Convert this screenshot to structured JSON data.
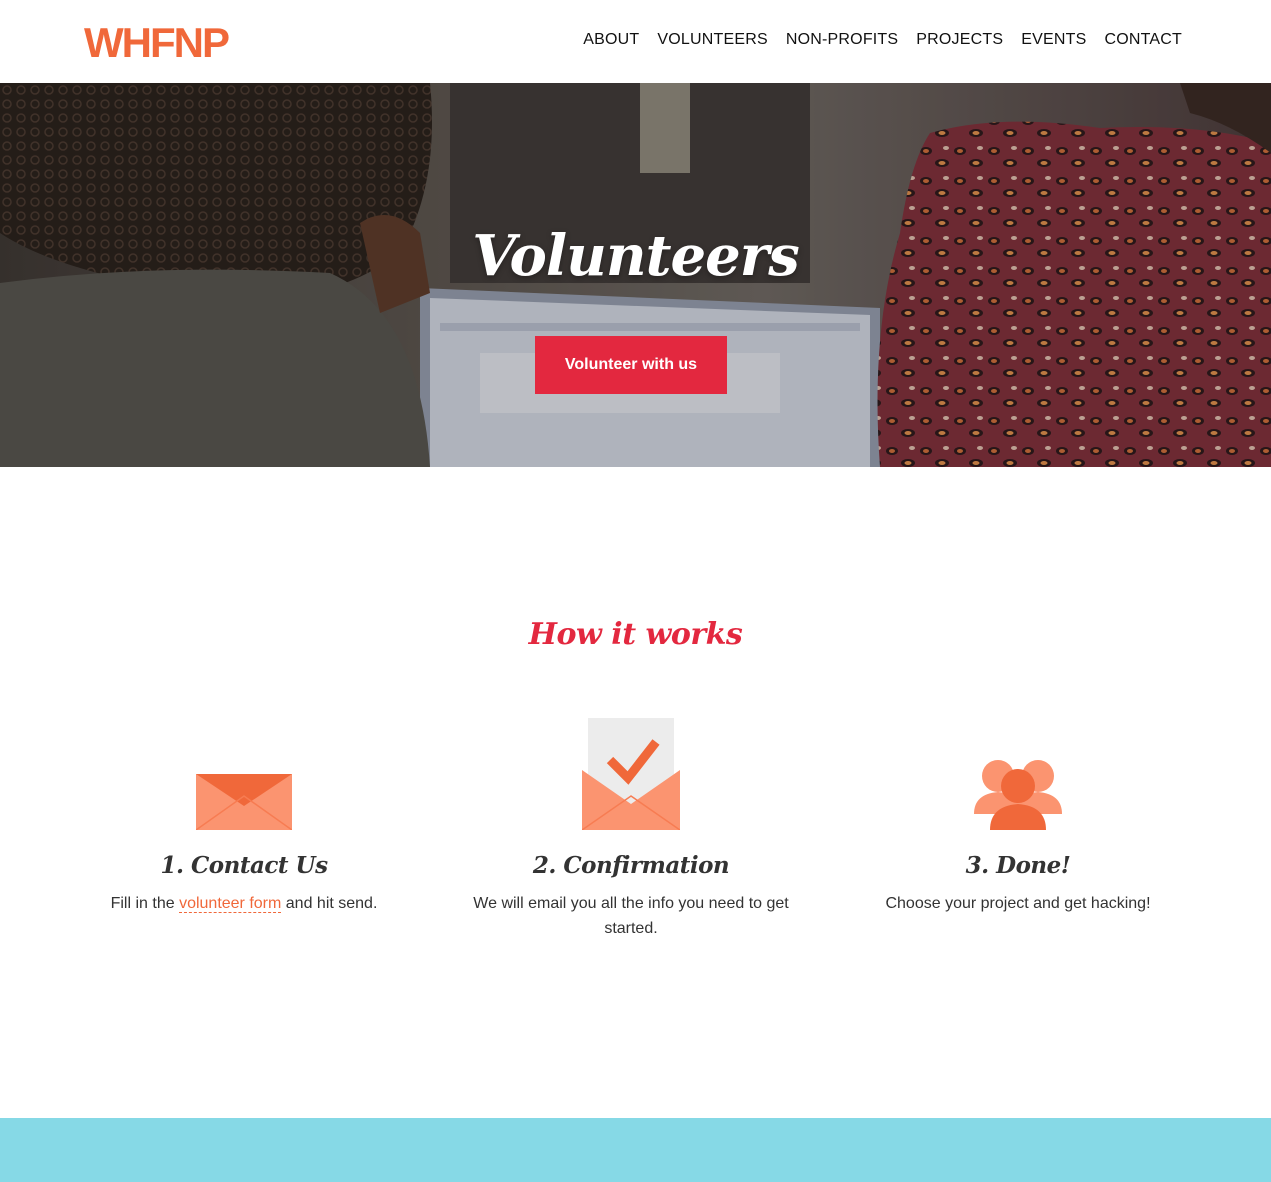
{
  "header": {
    "logo_text": "WHFNP",
    "nav": [
      {
        "label": "ABOUT"
      },
      {
        "label": "VOLUNTEERS"
      },
      {
        "label": "NON-PROFITS"
      },
      {
        "label": "PROJECTS"
      },
      {
        "label": "EVENTS"
      },
      {
        "label": "CONTACT"
      }
    ]
  },
  "hero": {
    "title": "Volunteers",
    "button_label": "Volunteer with us"
  },
  "how": {
    "title": "How it works",
    "steps": [
      {
        "icon": "envelope-icon",
        "title": "1. Contact Us",
        "text_before": "Fill in the ",
        "link": "volunteer form",
        "text_after": " and hit send."
      },
      {
        "icon": "confirmation-envelope-icon",
        "title": "2. Confirmation",
        "text": "We will email you all the info you need to get started."
      },
      {
        "icon": "group-icon",
        "title": "3. Done!",
        "text": "Choose your project and get hacking!"
      }
    ]
  },
  "colors": {
    "accent_red": "#e3283f",
    "accent_orange": "#f0683a",
    "footer_band": "#86d9e6"
  }
}
